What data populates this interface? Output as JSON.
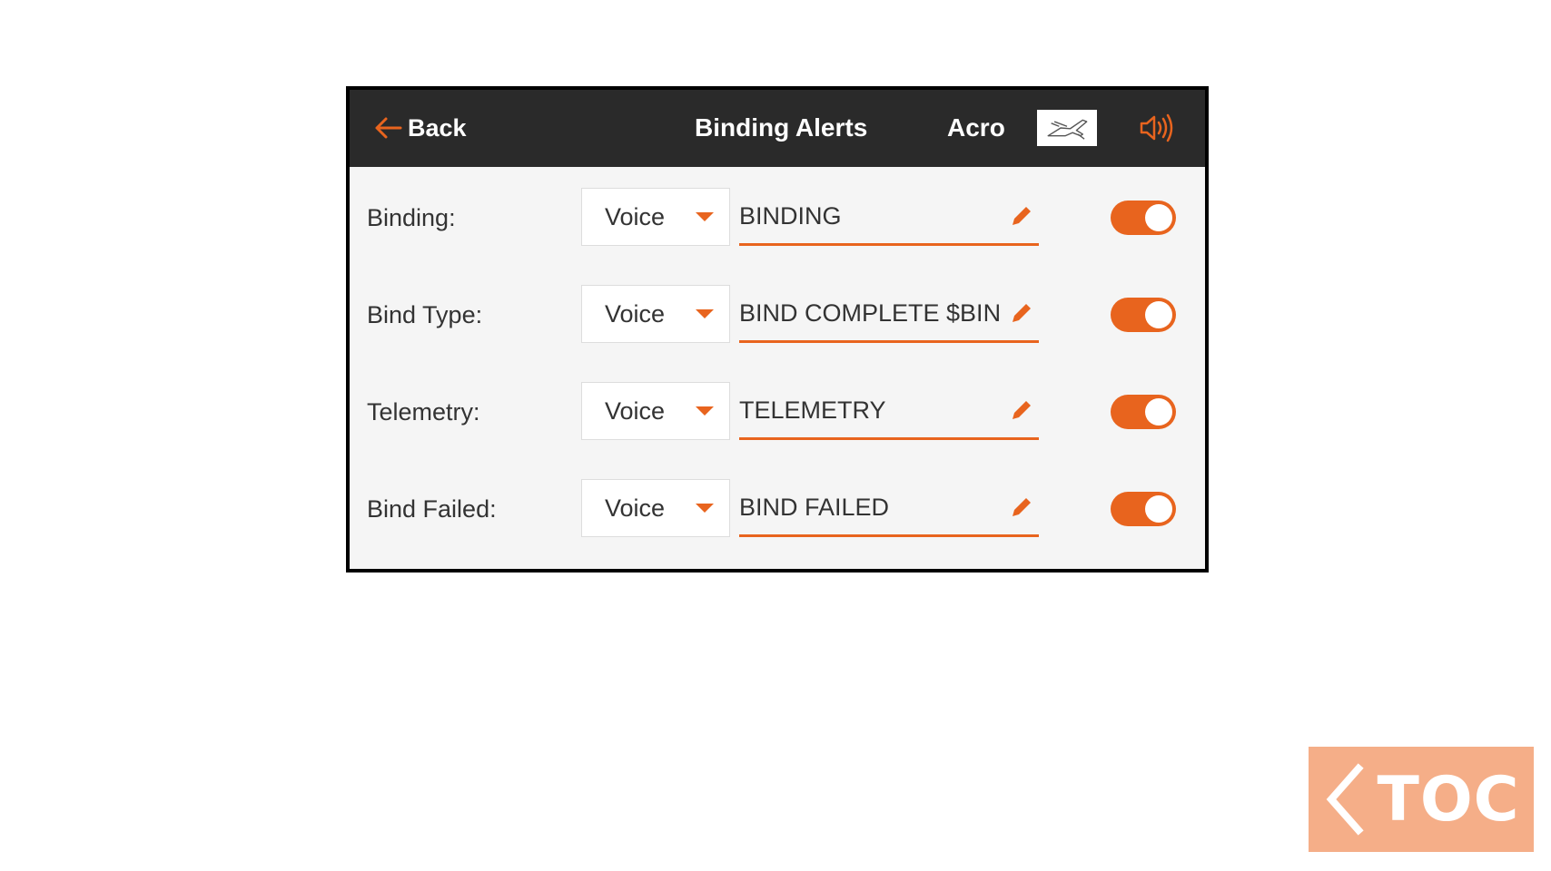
{
  "header": {
    "back_label": "Back",
    "title": "Binding Alerts",
    "model_name": "Acro",
    "model_icon": "airplane-icon",
    "speaker_icon": "speaker-icon"
  },
  "colors": {
    "accent": "#e8641e",
    "header_bg": "#2a2a2a",
    "screen_bg": "#f5f5f5",
    "toc_bg": "#f5ae88"
  },
  "rows": [
    {
      "label": "Binding:",
      "select_value": "Voice",
      "text_value": "BINDING",
      "enabled": true
    },
    {
      "label": "Bind Type:",
      "select_value": "Voice",
      "text_value": "BIND COMPLETE $BIN",
      "enabled": true
    },
    {
      "label": "Telemetry:",
      "select_value": "Voice",
      "text_value": "TELEMETRY",
      "enabled": true
    },
    {
      "label": "Bind Failed:",
      "select_value": "Voice",
      "text_value": "BIND FAILED",
      "enabled": true
    }
  ],
  "toc": {
    "label": "TOC"
  }
}
